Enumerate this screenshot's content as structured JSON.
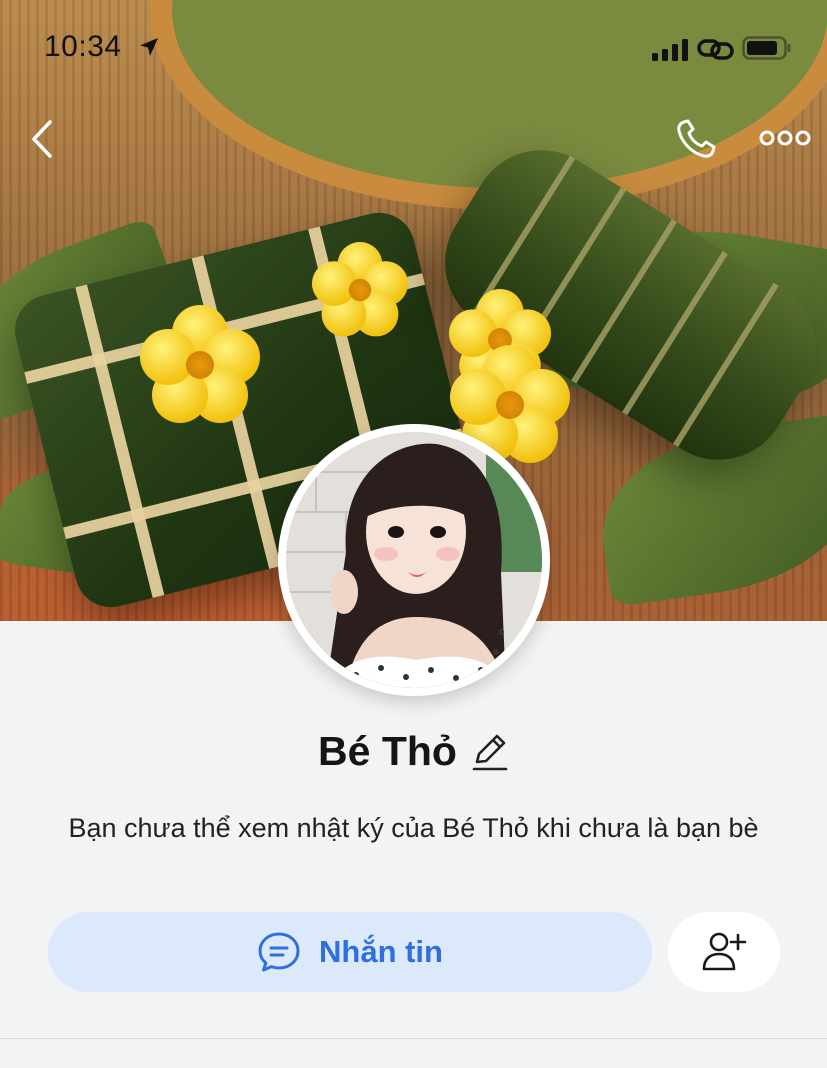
{
  "status_bar": {
    "time": "10:34"
  },
  "profile": {
    "name": "Bé Thỏ",
    "notice": "Bạn chưa thể xem nhật ký của Bé Thỏ khi chưa là bạn bè"
  },
  "actions": {
    "message_label": "Nhắn tin"
  },
  "icons": {
    "back": "chevron-left-icon",
    "call": "phone-icon",
    "more": "more-horizontal-icon",
    "edit": "pencil-icon",
    "message": "chat-bubble-icon",
    "add_friend": "add-user-icon"
  },
  "colors": {
    "accent": "#2f6fe0",
    "message_button_bg": "#dce9fb",
    "page_bg": "#f2f3f5"
  }
}
